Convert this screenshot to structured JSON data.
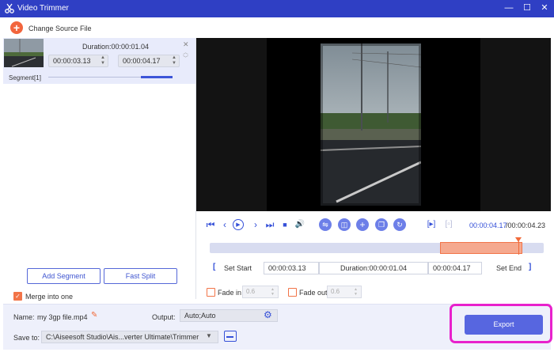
{
  "window": {
    "title": "Video Trimmer",
    "controls": {
      "minimize": "—",
      "maximize": "☐",
      "close": "✕"
    }
  },
  "source": {
    "change_label": "Change Source File"
  },
  "segment": {
    "duration": "Duration:00:00:01.04",
    "start": "00:00:03.13",
    "end": "00:00:04.17",
    "label": "Segment[1]"
  },
  "left_buttons": {
    "add_segment": "Add Segment",
    "fast_split": "Fast Split",
    "merge_label": "Merge into one",
    "merge_checked": true
  },
  "player": {
    "time_current": "00:00:04.17",
    "time_total": "/00:00:04.23",
    "icons": [
      "skip-start-icon",
      "prev-frame-icon",
      "play-icon",
      "next-frame-icon",
      "skip-end-icon",
      "stop-icon",
      "volume-icon",
      "flip-icon",
      "snapshot-icon",
      "add-icon",
      "copy-icon",
      "reset-icon",
      "mark-in-icon",
      "mark-out-icon"
    ]
  },
  "trim": {
    "set_start": "Set Start",
    "start_time": "00:00:03.13",
    "duration": "Duration:00:00:01.04",
    "end_time": "00:00:04.17",
    "set_end": "Set End",
    "bracket_open": "[",
    "bracket_close": "]"
  },
  "fade": {
    "fade_in_label": "Fade in",
    "fade_in_value": "0.6",
    "fade_out_label": "Fade out",
    "fade_out_value": "0.6"
  },
  "output": {
    "name_label": "Name:",
    "name_value": "my 3gp file.mp4",
    "output_label": "Output:",
    "output_value": "Auto;Auto",
    "save_label": "Save to:",
    "save_path": "C:\\Aiseesoft Studio\\Ais...verter Ultimate\\Trimmer",
    "export_label": "Export"
  },
  "colors": {
    "accent": "#3550d8",
    "orange": "#f27448",
    "highlight": "#e821cc",
    "titlebar": "#2f3fc4"
  }
}
